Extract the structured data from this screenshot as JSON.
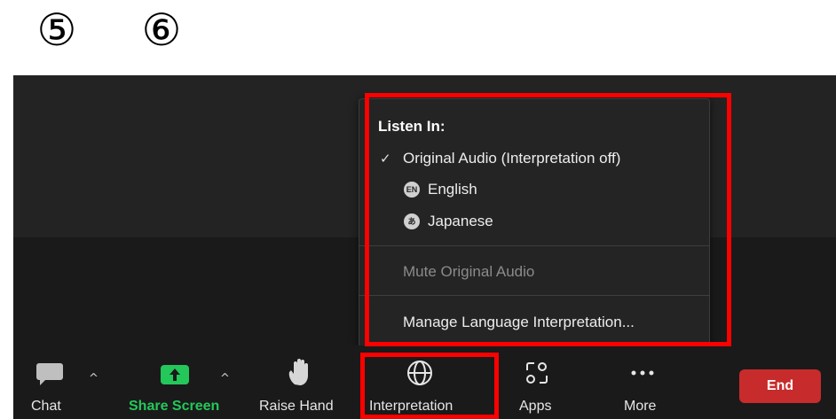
{
  "markers": {
    "first": "⑤",
    "second": "⑥"
  },
  "menu": {
    "title": "Listen In:",
    "original_audio": {
      "check": "✓",
      "label": "Original Audio (Interpretation off)"
    },
    "languages": [
      {
        "badge": "EN",
        "label": "English"
      },
      {
        "badge": "あ",
        "label": "Japanese"
      }
    ],
    "mute_original": "Mute Original Audio",
    "manage": "Manage Language Interpretation..."
  },
  "toolbar": {
    "chat": "Chat",
    "share_screen": "Share Screen",
    "raise_hand": "Raise Hand",
    "interpretation": "Interpretation",
    "apps": "Apps",
    "more": "More",
    "end": "End",
    "caret": "^"
  },
  "colors": {
    "highlight": "#ff0000",
    "share_green": "#24c75a",
    "end_red": "#c72b2b"
  },
  "icons": [
    "chat-icon",
    "share-screen-icon",
    "raise-hand-icon",
    "globe-icon",
    "apps-icon",
    "more-icon",
    "checkmark-icon"
  ]
}
